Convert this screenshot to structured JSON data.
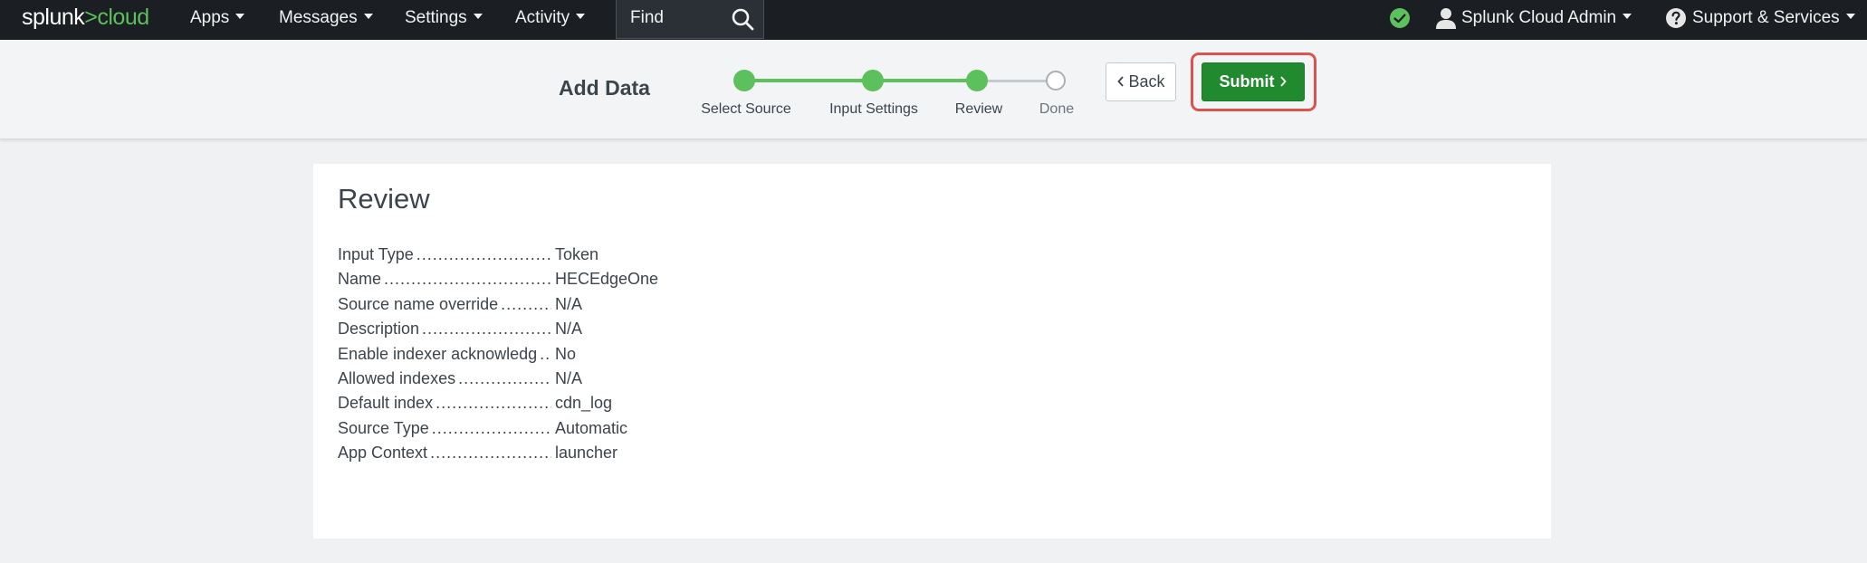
{
  "topbar": {
    "logo_main": "splunk",
    "logo_gt": ">",
    "logo_cloud": "cloud",
    "nav": [
      {
        "label": "Apps"
      },
      {
        "label": "Messages"
      },
      {
        "label": "Settings"
      },
      {
        "label": "Activity"
      }
    ],
    "find_label": "Find",
    "user_label": "Splunk Cloud Admin",
    "support_label": "Support & Services",
    "icons": {
      "status": "check-circle-icon",
      "user": "user-icon",
      "help": "question-circle-icon",
      "search": "search-icon"
    },
    "colors": {
      "background": "#1b1e22",
      "brand_green": "#5cc05c"
    }
  },
  "wizard": {
    "title": "Add Data",
    "steps": [
      {
        "label": "Select Source",
        "state": "complete"
      },
      {
        "label": "Input Settings",
        "state": "complete"
      },
      {
        "label": "Review",
        "state": "current"
      },
      {
        "label": "Done",
        "state": "pending"
      }
    ],
    "back_label": "Back",
    "submit_label": "Submit",
    "colors": {
      "step_complete": "#5cc05c",
      "submit": "#218a2e",
      "highlight": "#d9534f"
    }
  },
  "review": {
    "title": "Review",
    "rows": [
      {
        "label": "Input Type",
        "value": "Token"
      },
      {
        "label": "Name",
        "value": "HECEdgeOne"
      },
      {
        "label": "Source name override",
        "value": "N/A"
      },
      {
        "label": "Description",
        "value": "N/A"
      },
      {
        "label": "Enable indexer acknowledg",
        "value": "No"
      },
      {
        "label": "Allowed indexes",
        "value": "N/A"
      },
      {
        "label": "Default index",
        "value": "cdn_log"
      },
      {
        "label": "Source Type",
        "value": "Automatic"
      },
      {
        "label": "App Context",
        "value": "launcher"
      }
    ]
  }
}
